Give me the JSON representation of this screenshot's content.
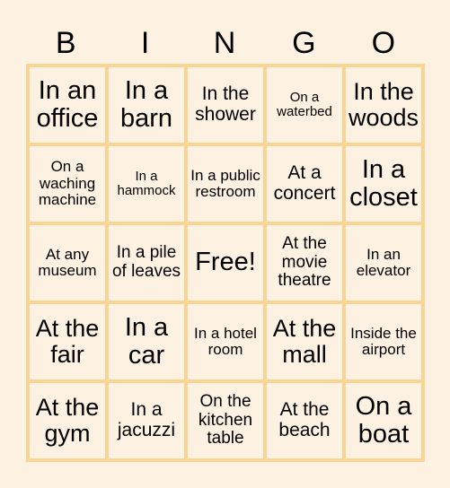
{
  "header": {
    "letters": [
      "B",
      "I",
      "N",
      "G",
      "O"
    ]
  },
  "colors": {
    "background": "#fdf1e2",
    "border": "#f8d594",
    "text": "#000000"
  },
  "cells": [
    [
      "In an office",
      "In a barn",
      "In the shower",
      "On a waterbed",
      "In the woods"
    ],
    [
      "On a waching machine",
      "In a hammock",
      "In a public restroom",
      "At a concert",
      "In a closet"
    ],
    [
      "At any museum",
      "In a pile of leaves",
      "Free!",
      "At the movie theatre",
      "In an elevator"
    ],
    [
      "At the fair",
      "In a car",
      "In a hotel room",
      "At the mall",
      "Inside the airport"
    ],
    [
      "At the gym",
      "In a jacuzzi",
      "On the kitchen table",
      "At the beach",
      "On a boat"
    ]
  ]
}
